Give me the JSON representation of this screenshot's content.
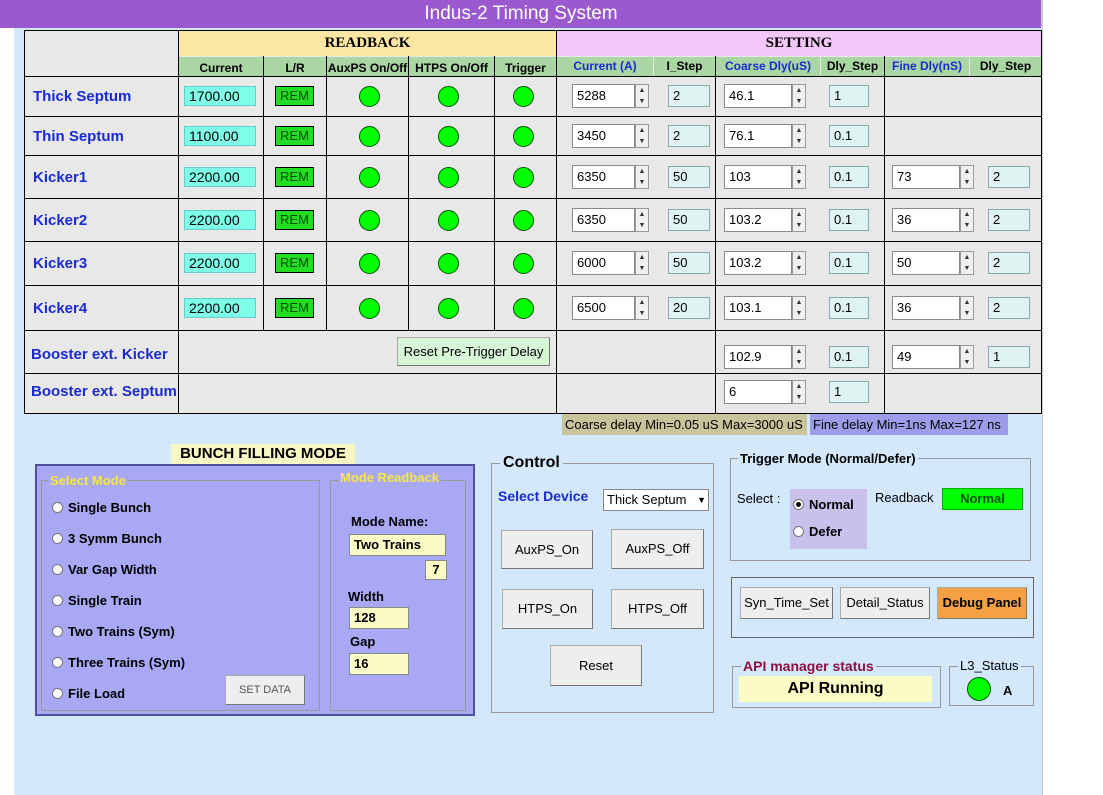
{
  "title": "Indus-2 Timing System",
  "headers": {
    "readback": "READBACK",
    "setting": "SETTING"
  },
  "columns": {
    "current": "Current",
    "lr": "L/R",
    "auxps": "AuxPS On/Off",
    "htps": "HTPS On/Off",
    "trigger": "Trigger",
    "set_current": "Current (A)",
    "i_step": "I_Step",
    "coarse": "Coarse Dly(uS)",
    "dly_step": "Dly_Step",
    "fine": "Fine Dly(nS)",
    "dly_step2": "Dly_Step"
  },
  "rows": [
    {
      "name": "Thick Septum",
      "current": "1700.00",
      "lr": "REM",
      "set_current": "5288",
      "i_step": "2",
      "coarse": "46.1",
      "dly_step": "1",
      "fine": "",
      "fine_step": ""
    },
    {
      "name": "Thin Septum",
      "current": "1100.00",
      "lr": "REM",
      "set_current": "3450",
      "i_step": "2",
      "coarse": "76.1",
      "dly_step": "0.1",
      "fine": "",
      "fine_step": ""
    },
    {
      "name": "Kicker1",
      "current": "2200.00",
      "lr": "REM",
      "set_current": "6350",
      "i_step": "50",
      "coarse": "103",
      "dly_step": "0.1",
      "fine": "73",
      "fine_step": "2"
    },
    {
      "name": "Kicker2",
      "current": "2200.00",
      "lr": "REM",
      "set_current": "6350",
      "i_step": "50",
      "coarse": "103.2",
      "dly_step": "0.1",
      "fine": "36",
      "fine_step": "2"
    },
    {
      "name": "Kicker3",
      "current": "2200.00",
      "lr": "REM",
      "set_current": "6000",
      "i_step": "50",
      "coarse": "103.2",
      "dly_step": "0.1",
      "fine": "50",
      "fine_step": "2"
    },
    {
      "name": "Kicker4",
      "current": "2200.00",
      "lr": "REM",
      "set_current": "6500",
      "i_step": "20",
      "coarse": "103.1",
      "dly_step": "0.1",
      "fine": "36",
      "fine_step": "2"
    }
  ],
  "booster_kicker": {
    "name": "Booster ext. Kicker",
    "coarse": "102.9",
    "dly_step": "0.1",
    "fine": "49",
    "fine_step": "1"
  },
  "booster_septum": {
    "name": "Booster ext. Septum",
    "coarse": "6",
    "dly_step": "1"
  },
  "reset_pretrigger": "Reset Pre-Trigger Delay",
  "coarse_range": "Coarse delay Min=0.05 uS Max=3000 uS",
  "fine_range": "Fine delay Min=1ns Max=127 ns",
  "bunch": {
    "title": "BUNCH FILLING MODE",
    "select_mode": "Select Mode",
    "modes": [
      "Single Bunch",
      "3 Symm Bunch",
      "Var Gap Width",
      "Single Train",
      "Two Trains (Sym)",
      "Three Trains (Sym)",
      "File Load"
    ],
    "set_data": "SET DATA",
    "readback_title": "Mode Readback",
    "mode_name_label": "Mode Name:",
    "mode_name": "Two Trains",
    "mode_num": "7",
    "width_label": "Width",
    "width": "128",
    "gap_label": "Gap",
    "gap": "16"
  },
  "control": {
    "title": "Control",
    "select_device": "Select Device",
    "device": "Thick Septum",
    "auxps_on": "AuxPS_On",
    "auxps_off": "AuxPS_Off",
    "htps_on": "HTPS_On",
    "htps_off": "HTPS_Off",
    "reset": "Reset"
  },
  "trigger": {
    "title": "Trigger Mode (Normal/Defer)",
    "select": "Select :",
    "normal": "Normal",
    "defer": "Defer",
    "readback_label": "Readback",
    "readback": "Normal"
  },
  "actions": {
    "syn": "Syn_Time_Set",
    "detail": "Detail_Status",
    "debug": "Debug Panel"
  },
  "api": {
    "title": "API manager status",
    "status": "API Running"
  },
  "l3": {
    "title": "L3_Status",
    "value": "A"
  },
  "colors": {
    "title_bar": "#9b59d0",
    "led": "#00ff00",
    "debug": "#f5a042",
    "readback_ok": "#00ff00"
  }
}
